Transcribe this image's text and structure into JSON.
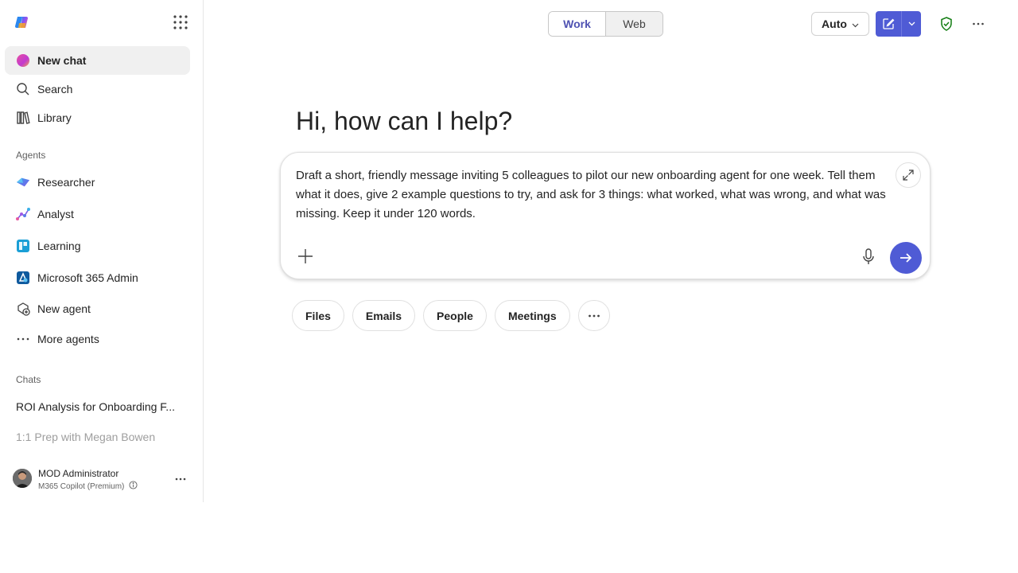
{
  "sidebar": {
    "nav": [
      {
        "label": "New chat",
        "icon": "copilot-orb-icon"
      },
      {
        "label": "Search",
        "icon": "search-icon"
      },
      {
        "label": "Library",
        "icon": "library-icon"
      }
    ],
    "agents_label": "Agents",
    "agents": [
      {
        "label": "Researcher",
        "icon": "researcher-icon"
      },
      {
        "label": "Analyst",
        "icon": "analyst-icon"
      },
      {
        "label": "Learning",
        "icon": "learning-icon"
      },
      {
        "label": "Microsoft 365 Admin",
        "icon": "m365-admin-icon"
      },
      {
        "label": "New agent",
        "icon": "new-agent-icon"
      },
      {
        "label": "More agents",
        "icon": "more-agents-icon"
      }
    ],
    "chats_label": "Chats",
    "chats": [
      {
        "label": "ROI Analysis for Onboarding F..."
      },
      {
        "label": "1:1 Prep with Megan Bowen"
      }
    ],
    "user": {
      "name": "MOD Administrator",
      "plan": "M365 Copilot (Premium)"
    }
  },
  "topbar": {
    "toggle": {
      "work": "Work",
      "web": "Web",
      "selected": "Work"
    },
    "model": "Auto"
  },
  "main": {
    "greeting": "Hi, how can I help?",
    "prompt": "Draft a short, friendly message inviting 5 colleagues to pilot our new onboarding agent for one week. Tell them what it does, give 2 example questions to try, and ask for 3 things: what worked, what was wrong, and what was missing. Keep it under 120 words.",
    "chips": [
      "Files",
      "Emails",
      "People",
      "Meetings"
    ]
  },
  "colors": {
    "accent": "#4f5bd5",
    "work_text": "#4f52b2",
    "shield": "#107c10"
  }
}
